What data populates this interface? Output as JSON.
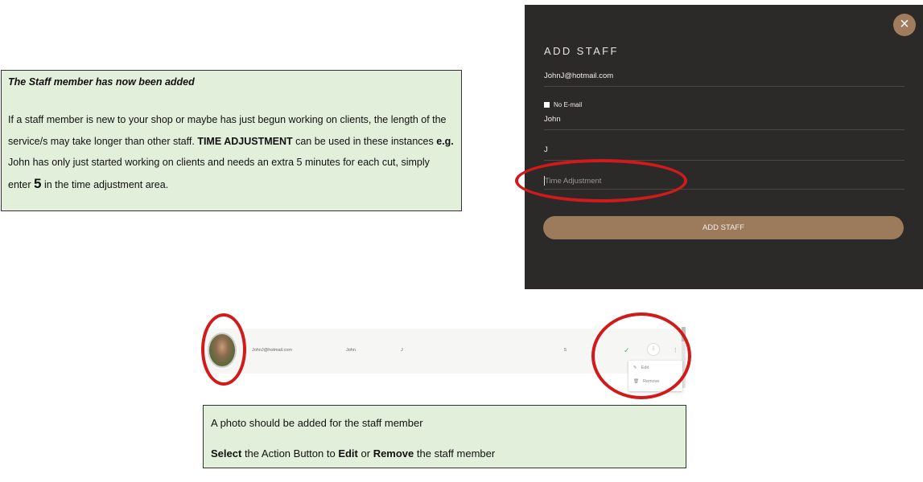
{
  "note1": {
    "title": "The Staff member has now been added",
    "p1": "If a  staff member is new to your shop or maybe has just begun working on clients, the length of the service/s may take longer than other staff.",
    "p1_bold": "TIME ADJUSTMENT",
    "p1_tail": "can be used in these instances",
    "eg": "e.g.",
    "p2": "John has only just started working on clients and needs an extra 5 minutes for each cut, simply enter",
    "big": "5",
    "p2_tail": "in the time adjustment area."
  },
  "modal": {
    "close_icon": "×",
    "title": "ADD STAFF",
    "email_value": "JohnJ@hotmail.com",
    "no_email_label": "No E-mail",
    "first_name_value": "John",
    "last_name_value": "J",
    "time_adjustment_placeholder": "Time Adjustment",
    "add_button": "ADD STAFF"
  },
  "staff_row": {
    "email": "JohnJ@hotmail.com",
    "first_name": "John",
    "last_name": "J",
    "time_adjustment": "5",
    "check_icon": "✓",
    "action_icon": "⁝",
    "kebab_icon": "⋮",
    "menu": {
      "edit": "Edit",
      "remove": "Remove",
      "edit_icon": "✎",
      "remove_icon": "🗑"
    }
  },
  "note2": {
    "line1": "A photo should be added for the staff member",
    "select": "Select",
    "mid1": "the Action Button to",
    "edit": "Edit",
    "or": "or",
    "remove": "Remove",
    "tail": "the staff member"
  },
  "colors": {
    "note_bg": "#e2efda",
    "modal_bg": "#2c2a29",
    "accent": "#9c7b5d",
    "highlight": "#d11a1a"
  }
}
